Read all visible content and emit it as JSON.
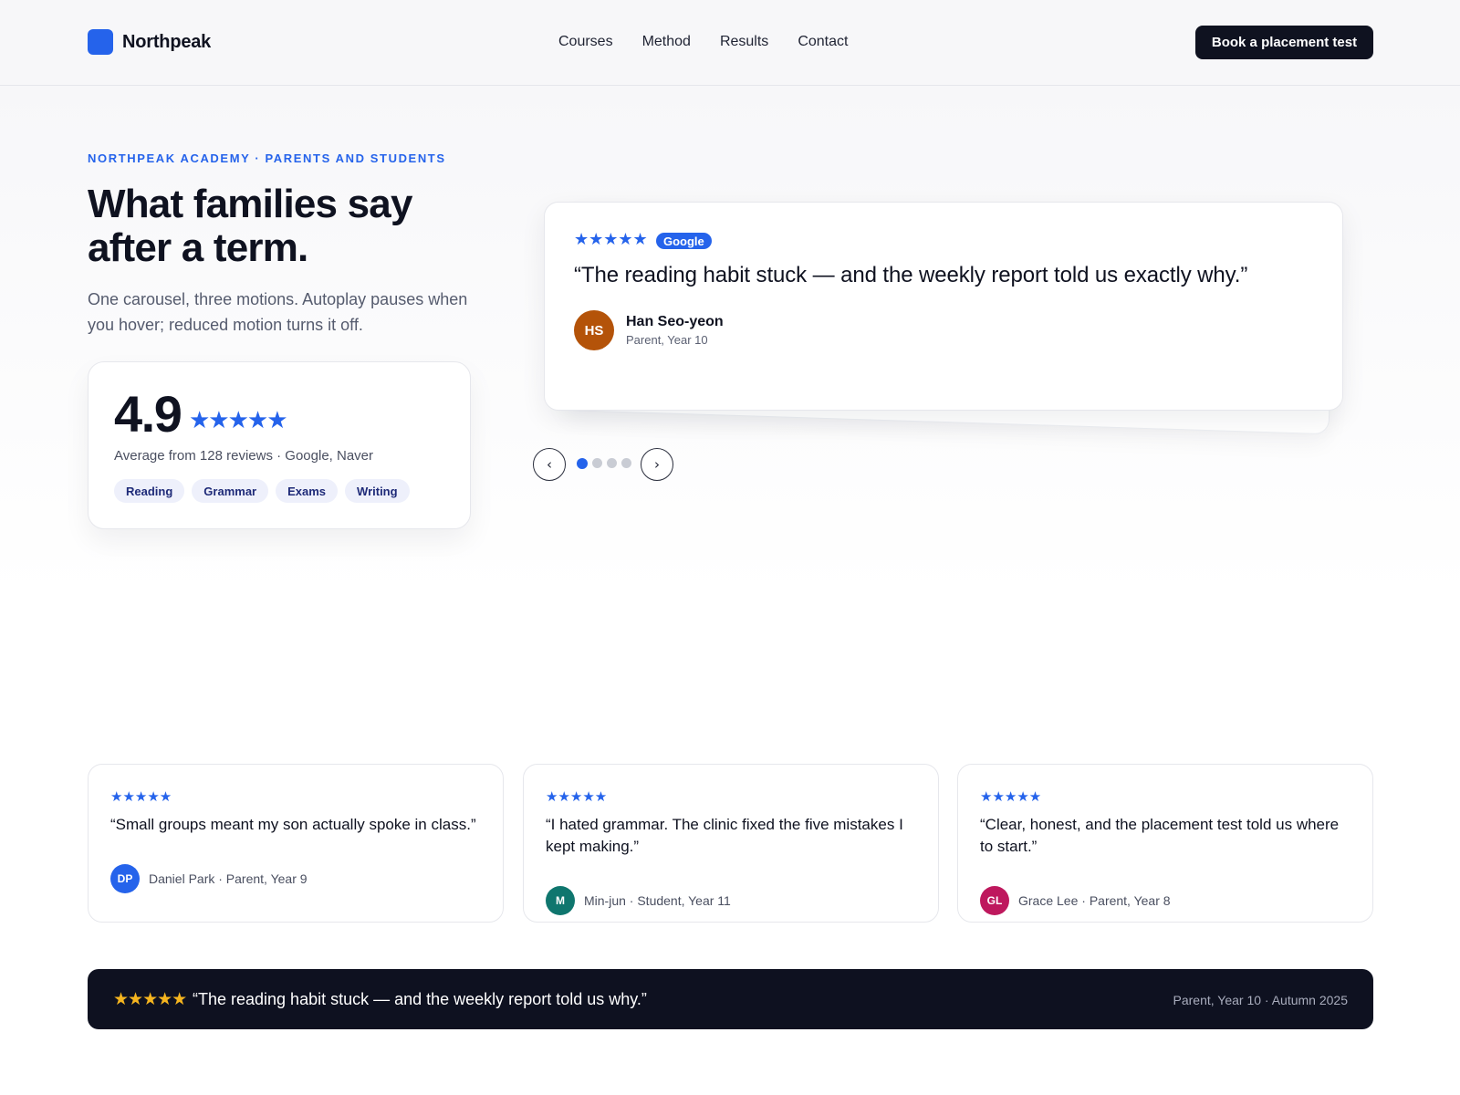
{
  "brand": {
    "name": "Northpeak",
    "accent": "#2563eb"
  },
  "nav": {
    "items": [
      "Courses",
      "Method",
      "Results",
      "Contact"
    ]
  },
  "header": {
    "cta_label": "Book a placement test"
  },
  "hero": {
    "eyebrow": "NORTHPEAK ACADEMY · PARENTS AND STUDENTS",
    "title": "What families say after a term.",
    "subtitle": "One carousel, three motions. Autoplay pauses when you hover; reduced motion turns it off."
  },
  "rating": {
    "score": "4.9",
    "stars": "★★★★★",
    "caption": "Average from 128 reviews · Google, Naver",
    "tags": [
      "Reading",
      "Grammar",
      "Exams",
      "Writing"
    ]
  },
  "carousel": {
    "active_index": 0,
    "slide_count": 4,
    "prev_glyph": "‹",
    "next_glyph": "›",
    "slide": {
      "stars": "★★★★★",
      "source": "Google",
      "quote": "“The reading habit stuck — and the weekly report told us exactly why.”",
      "initials": "HS",
      "name": "Han Seo-yeon",
      "role": "Parent, Year 10",
      "avatar_color": "#b45309"
    }
  },
  "reviews": [
    {
      "stars": "★★★★★",
      "quote": "“Small groups meant my son actually spoke in class.”",
      "initials": "DP",
      "who": "Daniel Park · Parent, Year 9",
      "avatar_color": "#2563eb"
    },
    {
      "stars": "★★★★★",
      "quote": "“I hated grammar. The clinic fixed the five mistakes I kept making.”",
      "initials": "M",
      "who": "Min-jun · Student, Year 11",
      "avatar_color": "#0f766e"
    },
    {
      "stars": "★★★★★",
      "quote": "“Clear, honest, and the placement test told us where to start.”",
      "initials": "GL",
      "who": "Grace Lee · Parent, Year 8",
      "avatar_color": "#be185d"
    }
  ],
  "ticker": {
    "stars": "★★★★★",
    "quote": "“The reading habit stuck — and the weekly report told us why.”",
    "meta": "Parent, Year 10 · Autumn 2025",
    "star_color": "#f5b51f"
  }
}
